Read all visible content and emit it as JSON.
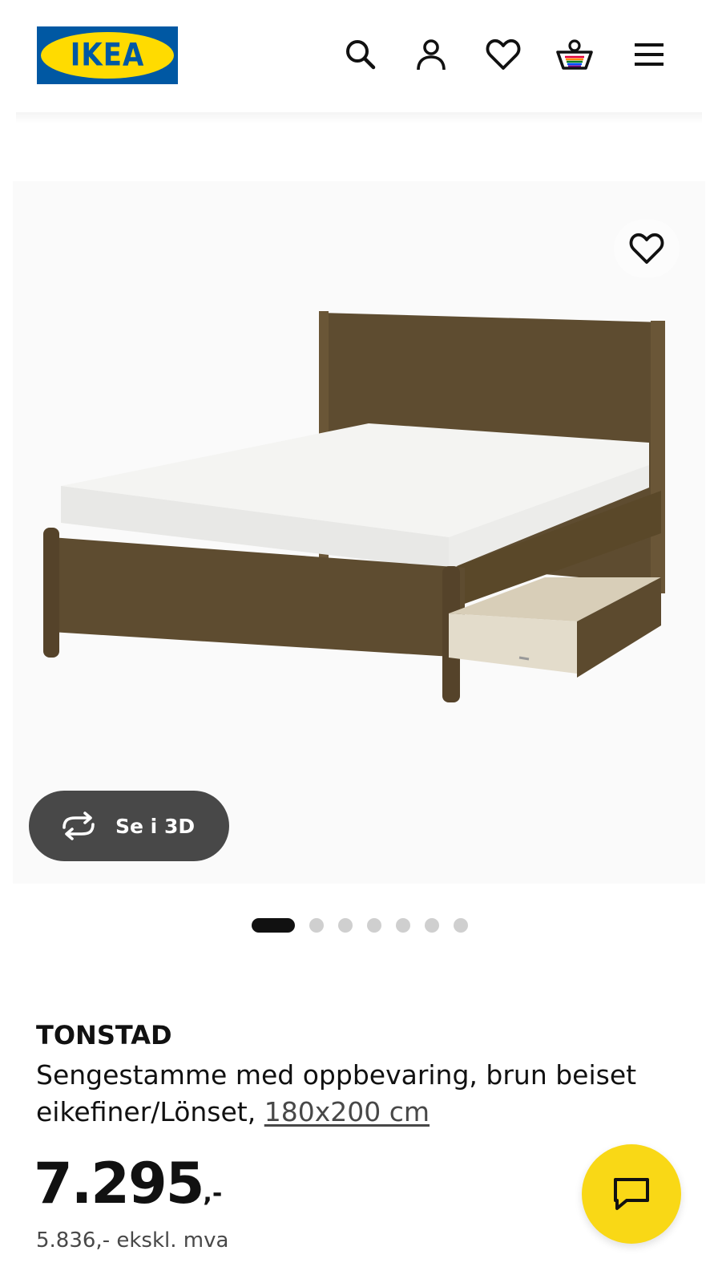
{
  "header": {
    "logo_text": "IKEA",
    "icons": [
      "search-icon",
      "account-icon",
      "favourites-icon",
      "cart-icon",
      "menu-icon"
    ]
  },
  "gallery": {
    "view_3d_label": "Se i 3D",
    "slide_count": 7,
    "active_slide": 1
  },
  "product": {
    "name": "TONSTAD",
    "description": "Sengestamme med oppbevaring, brun beiset eikefiner/Lönset, ",
    "size": "180x200 cm",
    "price_integer": "7.295",
    "price_suffix": ",-",
    "price_ex_vat": "5.836,- ekskl. mva"
  },
  "colors": {
    "brand_blue": "#0058a3",
    "brand_yellow": "#ffdb00",
    "chat_yellow": "#f9d816",
    "wood": "#5c4a2e"
  }
}
